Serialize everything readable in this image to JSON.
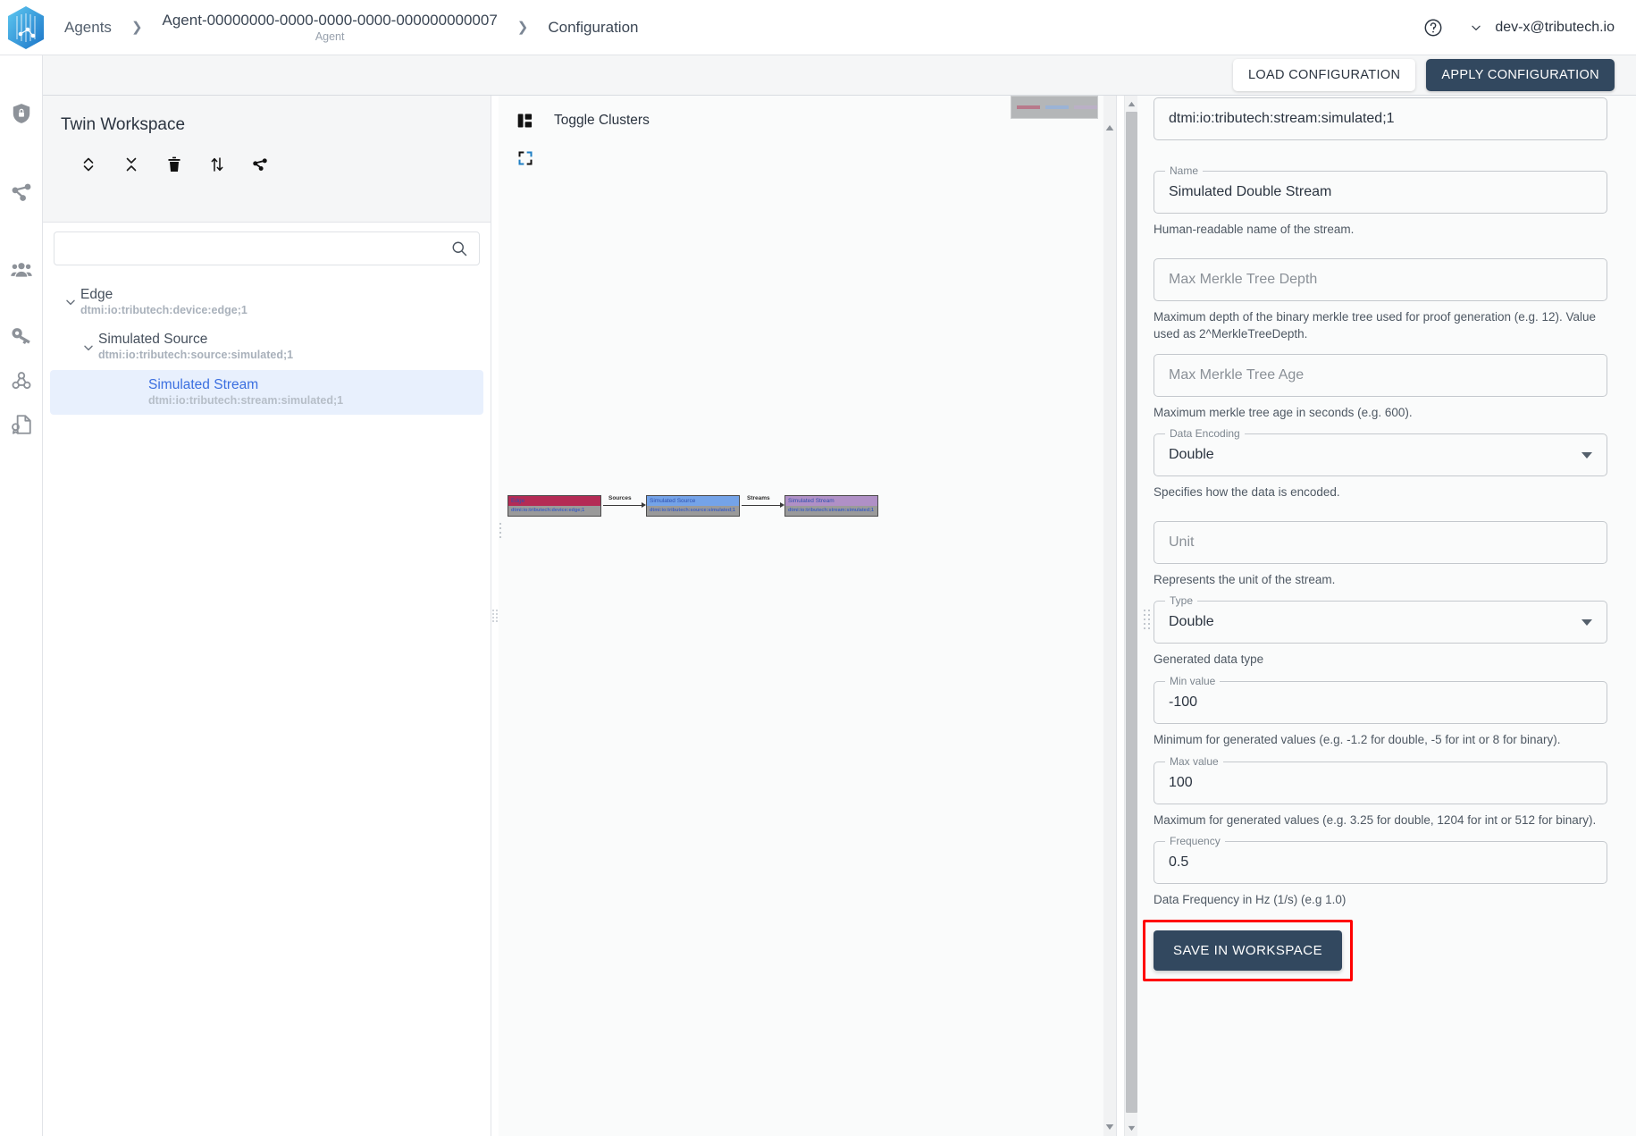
{
  "header": {
    "logo_icon": "tributech-hex-logo",
    "breadcrumb": [
      {
        "label": "Agents",
        "sub": null
      },
      {
        "label": "Agent-00000000-0000-0000-0000-000000000007",
        "sub": "Agent"
      },
      {
        "label": "Configuration",
        "sub": null
      }
    ],
    "separator": "❯",
    "help_icon": "help-circle-icon",
    "user_chevron_icon": "chevron-down-icon",
    "user_email": "dev-x@tributech.io"
  },
  "rail": {
    "items": [
      {
        "name": "security-shield",
        "icon": "shield-lock-icon"
      },
      {
        "name": "twin-graph",
        "icon": "share-nodes-icon"
      },
      {
        "name": "users",
        "icon": "people-group-icon"
      },
      {
        "name": "keys",
        "icon": "key-icon"
      },
      {
        "name": "webhooks",
        "icon": "webhook-icon"
      },
      {
        "name": "certificates",
        "icon": "certificate-document-icon"
      }
    ]
  },
  "actionbar": {
    "load_label": "LOAD CONFIGURATION",
    "apply_label": "APPLY CONFIGURATION"
  },
  "tree": {
    "title": "Twin Workspace",
    "tools": [
      {
        "name": "expand-all",
        "icon": "chevron-up-down-icon"
      },
      {
        "name": "collapse-all",
        "icon": "chevron-collapse-icon"
      },
      {
        "name": "delete",
        "icon": "trash-icon"
      },
      {
        "name": "sort",
        "icon": "sort-arrows-icon"
      },
      {
        "name": "hierarchy",
        "icon": "share-nodes-icon"
      }
    ],
    "search": {
      "value": "",
      "placeholder": "",
      "icon": "search-icon"
    },
    "items": [
      {
        "label": "Edge",
        "sub": "dtmi:io:tributech:device:edge;1",
        "level": 0,
        "expanded": true,
        "selected": false
      },
      {
        "label": "Simulated Source",
        "sub": "dtmi:io:tributech:source:simulated;1",
        "level": 1,
        "expanded": true,
        "selected": false
      },
      {
        "label": "Simulated Stream",
        "sub": "dtmi:io:tributech:stream:simulated;1",
        "level": 2,
        "expanded": false,
        "selected": true
      }
    ]
  },
  "graph": {
    "toggle_clusters_label": "Toggle Clusters",
    "toggle_clusters_icon": "panel-layout-icon",
    "fullscreen_icon": "fullscreen-expand-icon",
    "nodes": [
      {
        "title": "Edge",
        "sub": "dtmi:io:tributech:device:edge;1",
        "color": "#b42b55"
      },
      {
        "title": "Simulated Source",
        "sub": "dtmi:io:tributech:source:simulated;1",
        "color": "#74a3e8"
      },
      {
        "title": "Simulated Stream",
        "sub": "dtmi:io:tributech:stream:simulated;1",
        "color": "#b090c6"
      }
    ],
    "edges": [
      {
        "label": "Sources"
      },
      {
        "label": "Streams"
      }
    ],
    "minimap_icon": "minimap"
  },
  "form": {
    "dtmi": {
      "value": "dtmi:io:tributech:stream:simulated;1",
      "label": null,
      "hint": null,
      "placeholder": ""
    },
    "fields": [
      {
        "name": "name",
        "label": "Name",
        "value": "Simulated Double Stream",
        "placeholder": "Name",
        "hint": "Human-readable name of the stream.",
        "kind": "text",
        "filled": true
      },
      {
        "name": "max-merkle-tree-depth",
        "label": "",
        "value": "",
        "placeholder": "Max Merkle Tree Depth",
        "hint": "Maximum depth of the binary merkle tree used for proof generation (e.g. 12). Value used as 2^MerkleTreeDepth.",
        "kind": "text",
        "filled": false
      },
      {
        "name": "max-merkle-tree-age",
        "label": "",
        "value": "",
        "placeholder": "Max Merkle Tree Age",
        "hint": "Maximum merkle tree age in seconds (e.g. 600).",
        "kind": "text",
        "filled": false
      },
      {
        "name": "data-encoding",
        "label": "Data Encoding",
        "value": "Double",
        "placeholder": "Data Encoding",
        "hint": "Specifies how the data is encoded.",
        "kind": "select",
        "filled": true
      },
      {
        "name": "unit",
        "label": "",
        "value": "",
        "placeholder": "Unit",
        "hint": "Represents the unit of the stream.",
        "kind": "text",
        "filled": false
      },
      {
        "name": "type",
        "label": "Type",
        "value": "Double",
        "placeholder": "Type",
        "hint": "Generated data type",
        "kind": "select",
        "filled": true
      },
      {
        "name": "min-value",
        "label": "Min value",
        "value": "-100",
        "placeholder": "Min value",
        "hint": "Minimum for generated values (e.g. -1.2 for double, -5 for int or 8 for binary).",
        "kind": "text",
        "filled": true
      },
      {
        "name": "max-value",
        "label": "Max value",
        "value": "100",
        "placeholder": "Max value",
        "hint": "Maximum for generated values (e.g. 3.25 for double, 1204 for int or 512 for binary).",
        "kind": "text",
        "filled": true
      },
      {
        "name": "frequency",
        "label": "Frequency",
        "value": "0.5",
        "placeholder": "Frequency",
        "hint": "Data Frequency in Hz (1/s) (e.g 1.0)",
        "kind": "text",
        "filled": true
      }
    ],
    "save_label": "SAVE IN WORKSPACE",
    "highlight_color": "#ff0000"
  },
  "colors": {
    "navy": "#32485f",
    "accent_blue": "#3b6fe0",
    "selected_row_bg": "#e8f0fd",
    "panel_bg": "#fafbfb",
    "header_bg": "#f5f6f7"
  }
}
